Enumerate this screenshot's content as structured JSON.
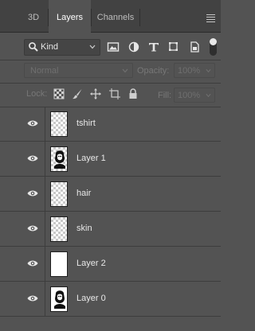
{
  "tabs": [
    {
      "label": "3D",
      "active": false
    },
    {
      "label": "Layers",
      "active": true
    },
    {
      "label": "Channels",
      "active": false
    }
  ],
  "panel_menu_icon": "hamburger-icon",
  "filter": {
    "kind_label": "Kind",
    "icons": [
      "image-filter-icon",
      "adjustment-filter-icon",
      "type-filter-icon",
      "shape-filter-icon",
      "smart-object-filter-icon"
    ]
  },
  "blend": {
    "mode": "Normal",
    "opacity_label": "Opacity:",
    "opacity_value": "100%"
  },
  "locks": {
    "label": "Lock:",
    "icons": [
      "lock-transparent-pixels-icon",
      "lock-image-pixels-icon",
      "lock-position-icon",
      "lock-artboard-icon",
      "lock-all-icon"
    ],
    "fill_label": "Fill:",
    "fill_value": "100%"
  },
  "layers": [
    {
      "name": "tshirt",
      "thumb": "transparent",
      "visible": true
    },
    {
      "name": "Layer 1",
      "thumb": "portrait",
      "visible": true
    },
    {
      "name": "hair",
      "thumb": "transparent",
      "visible": true
    },
    {
      "name": "skin",
      "thumb": "transparent",
      "visible": true
    },
    {
      "name": "Layer 2",
      "thumb": "white",
      "visible": true
    },
    {
      "name": "Layer 0",
      "thumb": "portrait",
      "visible": true
    }
  ],
  "colors": {
    "panel_bg": "#535353",
    "tabbar_bg": "#424242",
    "text": "#e8e8e8",
    "disabled_text": "#777777"
  }
}
